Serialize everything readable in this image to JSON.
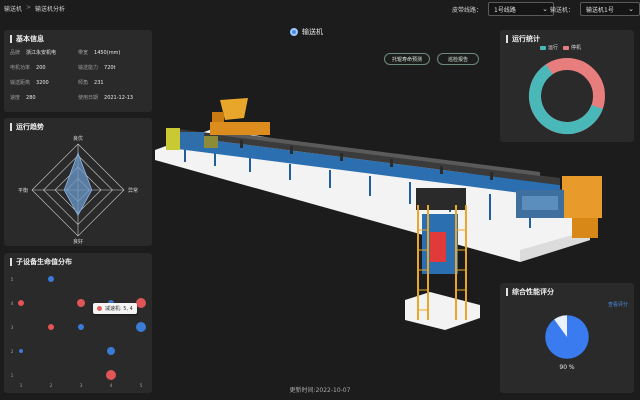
{
  "breadcrumb": {
    "parent": "输送机",
    "separator": ">",
    "current": "输送机分析"
  },
  "filters": {
    "line_label": "皮带线路：",
    "line_value": "1号线路",
    "machine_label": "输送机：",
    "machine_value": "输送机1号"
  },
  "center": {
    "title": "输送机",
    "btn_life": "托辊寿命预测",
    "btn_report": "巡检报告",
    "updated": "更新时间:2022-10-07"
  },
  "basic_info": {
    "title": "基本信息",
    "rows": [
      {
        "k1": "品牌",
        "v1": "浙江永安机电",
        "k2": "带宽",
        "v2": "1450(mm)"
      },
      {
        "k1": "电机功率",
        "v1": "200",
        "k2": "输送能力",
        "v2": "720t"
      },
      {
        "k1": "输送距离",
        "v1": "3200",
        "k2": "倾角",
        "v2": "231"
      },
      {
        "k1": "速度",
        "v1": "280",
        "k2": "使用日期",
        "v2": "2021-12-13"
      }
    ]
  },
  "trend": {
    "title": "运行趋势",
    "axes": [
      "良优",
      "异常",
      "良好",
      "平衡"
    ],
    "values": [
      0.8,
      0.3,
      0.55,
      0.3
    ]
  },
  "life_dist": {
    "title": "子设备生命值分布",
    "x_ticks": [
      "1",
      "2",
      "3",
      "4",
      "5"
    ],
    "y_ticks": [
      "1",
      "2",
      "3",
      "4",
      "5"
    ],
    "points": [
      {
        "x": 1,
        "y": 4,
        "r": 3,
        "color": "#e05555"
      },
      {
        "x": 2,
        "y": 5,
        "r": 3,
        "color": "#3a7bd5"
      },
      {
        "x": 2,
        "y": 3,
        "r": 3,
        "color": "#e05555"
      },
      {
        "x": 3,
        "y": 4,
        "r": 4,
        "color": "#e05555"
      },
      {
        "x": 3,
        "y": 3,
        "r": 3,
        "color": "#3a7bd5"
      },
      {
        "x": 4,
        "y": 4,
        "r": 3,
        "color": "#3a7bd5"
      },
      {
        "x": 5,
        "y": 4,
        "r": 5,
        "color": "#e05555"
      },
      {
        "x": 5,
        "y": 3,
        "r": 5,
        "color": "#3a7bd5"
      },
      {
        "x": 1,
        "y": 2,
        "r": 2,
        "color": "#3a7bd5"
      },
      {
        "x": 4,
        "y": 2,
        "r": 4,
        "color": "#3a7bd5"
      },
      {
        "x": 4,
        "y": 1,
        "r": 5,
        "color": "#e05555"
      }
    ],
    "tooltip": "减速机: 5, 4"
  },
  "run_stats": {
    "title": "运行统计",
    "legend": [
      {
        "label": "运行",
        "color": "#4ab8b8"
      },
      {
        "label": "停机",
        "color": "#e87d7d"
      }
    ],
    "run_pct": 60,
    "stop_pct": 40
  },
  "health": {
    "title": "综合性能评分",
    "link": "查看评分",
    "score_text": "90 %",
    "score": 90,
    "color": "#3a7bf0"
  },
  "colors": {
    "panel": "#2a2a2a",
    "bg": "#1c1c1c"
  }
}
